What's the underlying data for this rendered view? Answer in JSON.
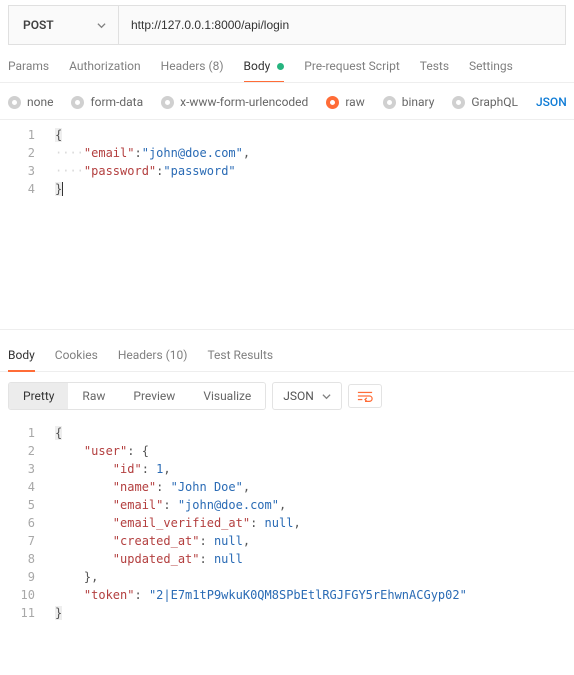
{
  "request": {
    "method": "POST",
    "url": "http://127.0.0.1:8000/api/login"
  },
  "tabs": {
    "params": "Params",
    "authorization": "Authorization",
    "headers": "Headers",
    "headers_count": "(8)",
    "body": "Body",
    "prerequest": "Pre-request Script",
    "tests": "Tests",
    "settings": "Settings"
  },
  "body_types": {
    "none": "none",
    "form_data": "form-data",
    "xwww": "x-www-form-urlencoded",
    "raw": "raw",
    "binary": "binary",
    "graphql": "GraphQL",
    "format": "JSON"
  },
  "request_body": {
    "ln1": "{",
    "ln2_key": "\"email\"",
    "ln2_val": "\"john@doe.com\"",
    "ln3_key": "\"password\"",
    "ln3_val": "\"password\"",
    "ln4": "}"
  },
  "resp_tabs": {
    "body": "Body",
    "cookies": "Cookies",
    "headers": "Headers",
    "headers_count": "(10)",
    "test_results": "Test Results"
  },
  "resp_toolbar": {
    "pretty": "Pretty",
    "raw": "Raw",
    "preview": "Preview",
    "visualize": "Visualize",
    "format": "JSON"
  },
  "response_body": {
    "ln1": "{",
    "user_key": "\"user\"",
    "id_key": "\"id\"",
    "id_val": "1",
    "name_key": "\"name\"",
    "name_val": "\"John Doe\"",
    "email_key": "\"email\"",
    "email_val": "\"john@doe.com\"",
    "ev_key": "\"email_verified_at\"",
    "null": "null",
    "created_key": "\"created_at\"",
    "updated_key": "\"updated_at\"",
    "token_key": "\"token\"",
    "token_val": "\"2|E7m1tP9wkuK0QM8SPbEtlRGJFGY5rEhwnACGyp02\"",
    "close": "}"
  }
}
